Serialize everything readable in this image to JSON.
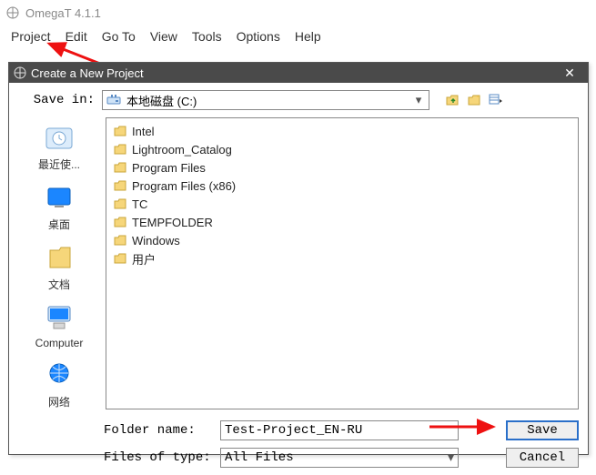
{
  "app": {
    "title": "OmegaT 4.1.1"
  },
  "menu": {
    "project": "Project",
    "edit": "Edit",
    "goto": "Go To",
    "view": "View",
    "tools": "Tools",
    "options": "Options",
    "help": "Help"
  },
  "dialog": {
    "title": "Create a New Project",
    "close": "✕",
    "savein_label": "Save in:",
    "savein_value": "本地磁盘 (C:)",
    "sidebar": {
      "recent": "最近使...",
      "desktop": "桌面",
      "documents": "文档",
      "computer": "Computer",
      "network": "网络"
    },
    "files": [
      "Intel",
      "Lightroom_Catalog",
      "Program Files",
      "Program Files (x86)",
      "TC",
      "TEMPFOLDER",
      "Windows",
      "用户"
    ],
    "foldername_label": "Folder name:",
    "foldername_value": "Test-Project_EN-RU",
    "filetype_label": "Files of type:",
    "filetype_value": "All Files",
    "save_btn": "Save",
    "cancel_btn": "Cancel"
  }
}
